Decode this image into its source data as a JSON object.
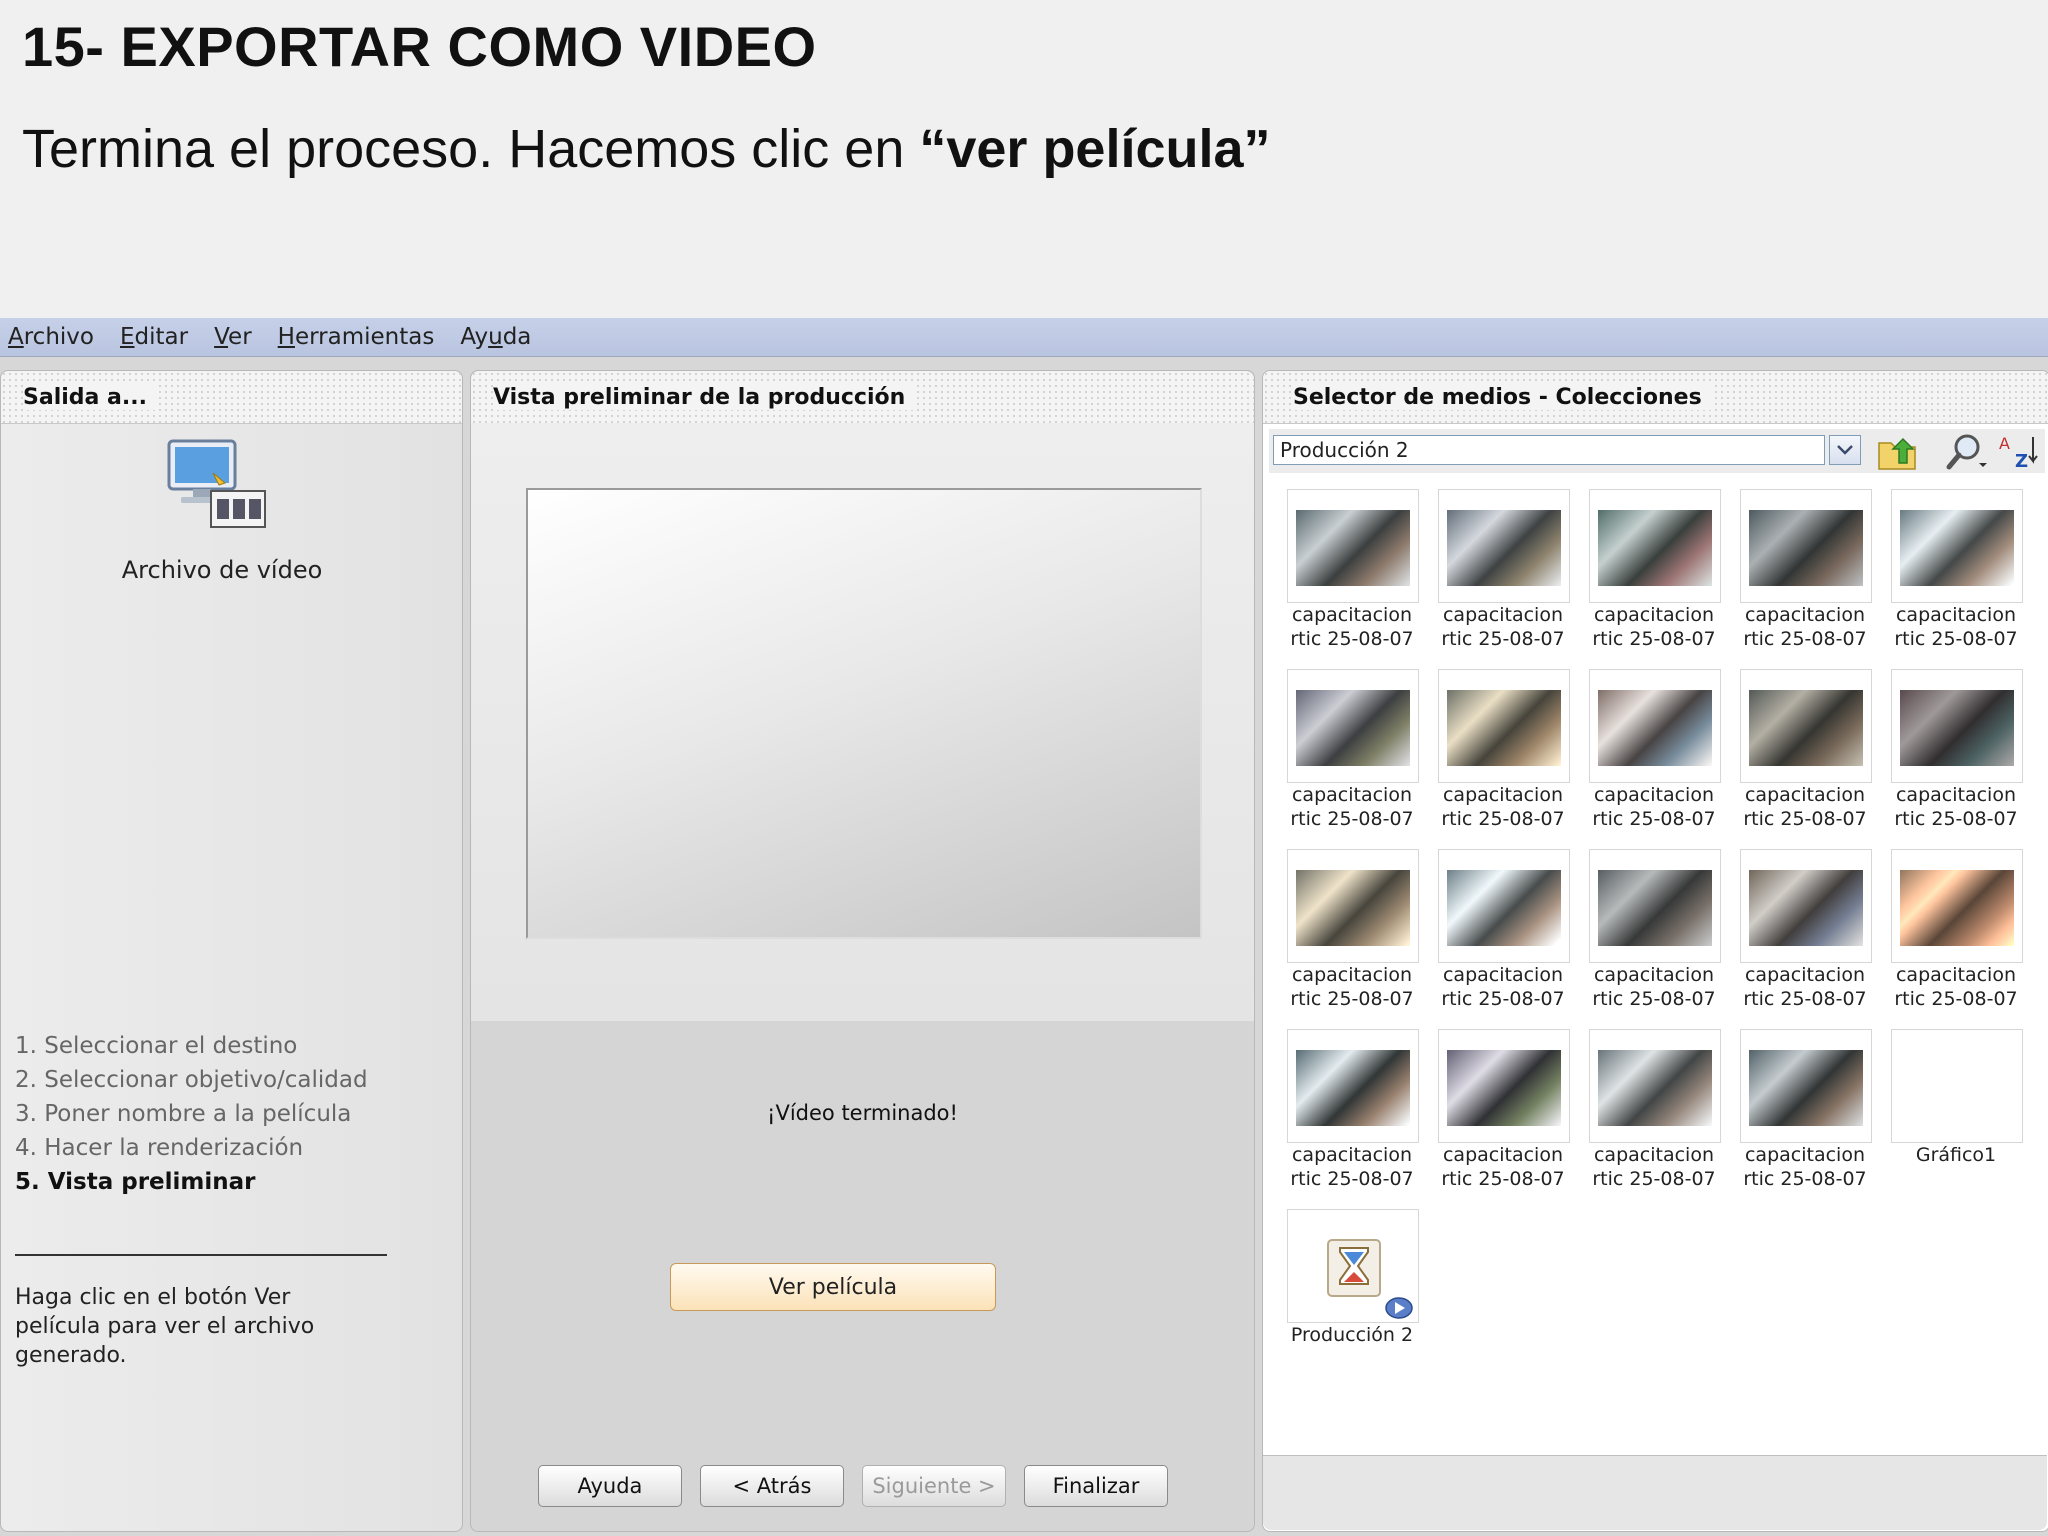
{
  "slide": {
    "title": "15- EXPORTAR COMO VIDEO",
    "subtitle_prefix": "Termina el proceso. Hacemos clic en ",
    "subtitle_bold": "“ver película”"
  },
  "menubar": {
    "items": [
      {
        "first": "A",
        "rest": "rchivo"
      },
      {
        "first": "E",
        "rest": "ditar"
      },
      {
        "first": "V",
        "rest": "er"
      },
      {
        "first": "H",
        "rest": "erramientas"
      },
      {
        "pre": "Ay",
        "first": "u",
        "rest": "da"
      }
    ]
  },
  "left_panel": {
    "title": "Salida a...",
    "output_label": "Archivo de vídeo",
    "steps": [
      "1. Seleccionar el destino",
      "2. Seleccionar objetivo/calidad",
      "3. Poner nombre a la película",
      "4. Hacer la renderización",
      "5. Vista preliminar"
    ],
    "active_step": 4,
    "help_text": "Haga clic en el botón Ver película para ver el archivo generado."
  },
  "middle_panel": {
    "title": "Vista preliminar de la producción",
    "status": "¡Vídeo terminado!",
    "watch_button": "Ver película",
    "buttons": {
      "help": "Ayuda",
      "back": "< Atrás",
      "next": "Siguiente >",
      "finish": "Finalizar"
    },
    "next_enabled": false
  },
  "right_panel": {
    "title": "Selector de medios - Colecciones",
    "collection": "Producción 2",
    "items": [
      {
        "l1": "capacitacion",
        "l2": "rtic 25-08-07",
        "kind": "photo"
      },
      {
        "l1": "capacitacion",
        "l2": "rtic 25-08-07",
        "kind": "photo"
      },
      {
        "l1": "capacitacion",
        "l2": "rtic 25-08-07",
        "kind": "photo"
      },
      {
        "l1": "capacitacion",
        "l2": "rtic 25-08-07",
        "kind": "photo"
      },
      {
        "l1": "capacitacion",
        "l2": "rtic 25-08-07",
        "kind": "photo"
      },
      {
        "l1": "capacitacion",
        "l2": "rtic 25-08-07",
        "kind": "photo"
      },
      {
        "l1": "capacitacion",
        "l2": "rtic 25-08-07",
        "kind": "photo"
      },
      {
        "l1": "capacitacion",
        "l2": "rtic 25-08-07",
        "kind": "photo"
      },
      {
        "l1": "capacitacion",
        "l2": "rtic 25-08-07",
        "kind": "photo"
      },
      {
        "l1": "capacitacion",
        "l2": "rtic 25-08-07",
        "kind": "photo"
      },
      {
        "l1": "capacitacion",
        "l2": "rtic 25-08-07",
        "kind": "photo"
      },
      {
        "l1": "capacitacion",
        "l2": "rtic 25-08-07",
        "kind": "photo"
      },
      {
        "l1": "capacitacion",
        "l2": "rtic 25-08-07",
        "kind": "photo"
      },
      {
        "l1": "capacitacion",
        "l2": "rtic 25-08-07",
        "kind": "photo"
      },
      {
        "l1": "capacitacion",
        "l2": "rtic 25-08-07",
        "kind": "photo"
      },
      {
        "l1": "capacitacion",
        "l2": "rtic 25-08-07",
        "kind": "photo"
      },
      {
        "l1": "capacitacion",
        "l2": "rtic 25-08-07",
        "kind": "photo"
      },
      {
        "l1": "capacitacion",
        "l2": "rtic 25-08-07",
        "kind": "photo"
      },
      {
        "l1": "capacitacion",
        "l2": "rtic 25-08-07",
        "kind": "photo"
      },
      {
        "l1": "Gráfico1",
        "l2": "",
        "kind": "blank"
      },
      {
        "l1": "Producción 2",
        "l2": "",
        "kind": "production"
      }
    ]
  },
  "icons": {
    "output": "video-file-icon",
    "combo_arrow": "chevron-down-icon",
    "up_folder": "folder-up-icon",
    "search": "magnifier-icon",
    "sort": "sort-az-icon",
    "production": "hourglass-icon"
  },
  "colors": {
    "menubar": "#c6d0e8",
    "watch_button": "#fbe2b8",
    "accent_border": "#7f9db9"
  }
}
